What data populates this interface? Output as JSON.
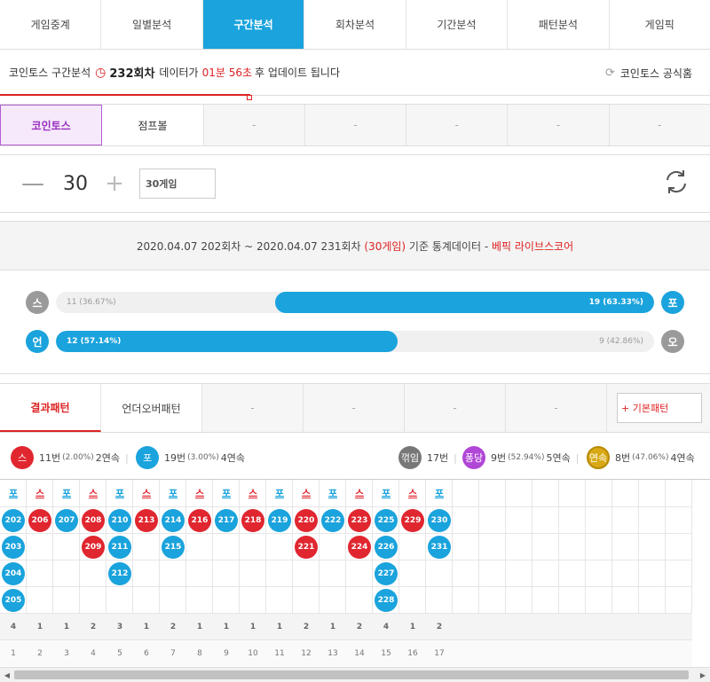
{
  "nav": {
    "tabs": [
      {
        "label": "게임중계",
        "active": false
      },
      {
        "label": "일별분석",
        "active": false
      },
      {
        "label": "구간분석",
        "active": true
      },
      {
        "label": "회차분석",
        "active": false
      },
      {
        "label": "기간분석",
        "active": false
      },
      {
        "label": "패턴분석",
        "active": false
      },
      {
        "label": "게임픽",
        "active": false
      }
    ]
  },
  "info": {
    "prefix": "코인토스 구간분석",
    "round": "232회차",
    "middle": "데이터가",
    "timer": "01분 56초",
    "suffix": "후 업데이트 됩니다",
    "home_link": "코인토스 공식홈"
  },
  "game_tabs": [
    {
      "label": "코인토스",
      "state": "active"
    },
    {
      "label": "점프볼",
      "state": "plain"
    },
    {
      "label": "-",
      "state": "disabled"
    },
    {
      "label": "-",
      "state": "disabled"
    },
    {
      "label": "-",
      "state": "disabled"
    },
    {
      "label": "-",
      "state": "disabled"
    },
    {
      "label": "-",
      "state": "disabled"
    }
  ],
  "stepper": {
    "minus": "—",
    "value": "30",
    "plus": "+",
    "games_label": "30게임"
  },
  "stats": {
    "header_pre": "2020.04.07 202회차 ~ 2020.04.07 231회차",
    "header_games": "(30게임)",
    "header_mid": "기준 통계데이터 -",
    "header_brand": "베픽 라이브스코어",
    "rows": [
      {
        "left_label": "스",
        "right_label": "포",
        "left_text": "11 (36.67%)",
        "right_text": "19 (63.33%)",
        "left_fraction": 0.3667,
        "fill_side": "right",
        "left_color": "gray",
        "right_color": "blue"
      },
      {
        "left_label": "언",
        "right_label": "오",
        "left_text": "12 (57.14%)",
        "right_text": "9 (42.86%)",
        "left_fraction": 0.5714,
        "fill_side": "left",
        "left_color": "blue",
        "right_color": "gray"
      }
    ]
  },
  "pattern_tabs": [
    {
      "label": "결과패턴",
      "state": "active"
    },
    {
      "label": "언더오버패턴",
      "state": "plain"
    },
    {
      "label": "-",
      "state": "disabled"
    },
    {
      "label": "-",
      "state": "disabled"
    },
    {
      "label": "-",
      "state": "disabled"
    },
    {
      "label": "-",
      "state": "disabled"
    }
  ],
  "basic_pattern_button": "+ 기본패턴",
  "legend": {
    "s": {
      "badge": "스",
      "count": "11번",
      "pct": "(2.00%)",
      "streak": "2연속",
      "color": "#e0262f"
    },
    "po": {
      "badge": "포",
      "count": "19번",
      "pct": "(3.00%)",
      "streak": "4연속",
      "color": "#1aa3dc"
    },
    "break": {
      "badge": "꺾임",
      "count": "17번"
    },
    "pongdang": {
      "badge": "퐁당",
      "count": "9번",
      "pct": "(52.94%)",
      "streak": "5연속"
    },
    "streak": {
      "badge": "연속",
      "count": "8번",
      "pct": "(47.06%)",
      "streak": "4연속"
    },
    "separator": "|"
  },
  "grid": {
    "columns": [
      {
        "head": "포",
        "type": "po",
        "balls": [
          "202",
          "203",
          "204",
          "205"
        ],
        "count": "4",
        "index": "1"
      },
      {
        "head": "스",
        "type": "s",
        "balls": [
          "206"
        ],
        "count": "1",
        "index": "2"
      },
      {
        "head": "포",
        "type": "po",
        "balls": [
          "207"
        ],
        "count": "1",
        "index": "3"
      },
      {
        "head": "스",
        "type": "s",
        "balls": [
          "208",
          "209"
        ],
        "count": "2",
        "index": "4"
      },
      {
        "head": "포",
        "type": "po",
        "balls": [
          "210",
          "211",
          "212"
        ],
        "count": "3",
        "index": "5"
      },
      {
        "head": "스",
        "type": "s",
        "balls": [
          "213"
        ],
        "count": "1",
        "index": "6"
      },
      {
        "head": "포",
        "type": "po",
        "balls": [
          "214",
          "215"
        ],
        "count": "2",
        "index": "7"
      },
      {
        "head": "스",
        "type": "s",
        "balls": [
          "216"
        ],
        "count": "1",
        "index": "8"
      },
      {
        "head": "포",
        "type": "po",
        "balls": [
          "217"
        ],
        "count": "1",
        "index": "9"
      },
      {
        "head": "스",
        "type": "s",
        "balls": [
          "218"
        ],
        "count": "1",
        "index": "10"
      },
      {
        "head": "포",
        "type": "po",
        "balls": [
          "219"
        ],
        "count": "1",
        "index": "11"
      },
      {
        "head": "스",
        "type": "s",
        "balls": [
          "220",
          "221"
        ],
        "count": "2",
        "index": "12"
      },
      {
        "head": "포",
        "type": "po",
        "balls": [
          "222"
        ],
        "count": "1",
        "index": "13"
      },
      {
        "head": "스",
        "type": "s",
        "balls": [
          "223",
          "224"
        ],
        "count": "2",
        "index": "14"
      },
      {
        "head": "포",
        "type": "po",
        "balls": [
          "225",
          "226",
          "227",
          "228"
        ],
        "count": "4",
        "index": "15"
      },
      {
        "head": "스",
        "type": "s",
        "balls": [
          "229"
        ],
        "count": "1",
        "index": "16"
      },
      {
        "head": "포",
        "type": "po",
        "balls": [
          "230",
          "231"
        ],
        "count": "2",
        "index": "17"
      }
    ],
    "empty_columns": 9
  },
  "icons": {
    "clock": "clock-icon",
    "home": "link-icon",
    "refresh": "refresh-icon",
    "scroll_left": "arrow-left-icon",
    "scroll_right": "arrow-right-icon"
  },
  "colors": {
    "accent_blue": "#1aa3dc",
    "red": "#e0262f",
    "purple": "#9a2fbf"
  }
}
